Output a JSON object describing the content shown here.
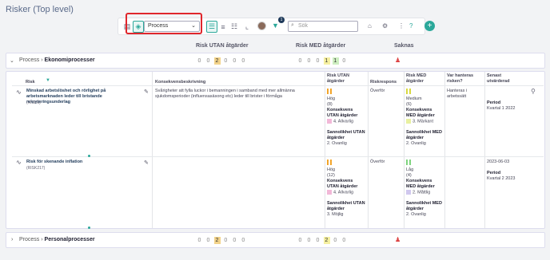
{
  "page": {
    "title": "Risker (Top level)"
  },
  "toolbar": {
    "select_value": "Process",
    "search_placeholder": "Sök",
    "filter_badge": "1",
    "add_label": "+"
  },
  "columns": {
    "risk_utan": "Risk UTAN åtgärder",
    "risk_med": "Risk MED åtgärder",
    "saknas": "Saknas"
  },
  "groups": [
    {
      "prefix": "Process",
      "name": "Ekonomiprocesser",
      "utan": [
        "0",
        "0",
        "2",
        "0",
        "0",
        "0"
      ],
      "med": [
        "0",
        "0",
        "0",
        "1",
        "1",
        "0"
      ]
    },
    {
      "prefix": "Process",
      "name": "Personalprocesser",
      "utan": [
        "0",
        "0",
        "2",
        "0",
        "0",
        "0"
      ],
      "med": [
        "0",
        "0",
        "0",
        "2",
        "0",
        "0"
      ]
    }
  ],
  "table": {
    "headers": {
      "risk": "Risk",
      "konsekvens": "Konsekvensbeskrivning",
      "risk_utan": "Risk UTAN åtgärder",
      "riskrespons": "Riskrespons",
      "risk_med": "Risk MED åtgärder",
      "hanteras": "Var hanteras risken?",
      "senast": "Senast utvärderad"
    },
    "rows": [
      {
        "name": "Minskad arbetslöshet och rörlighet på arbetsmarknaden leder till bristande rekryteringsunderlag",
        "id": "(RISK6)",
        "konsekvens": "Svårigheter att fylla luckor i bemanningen i samband med mer allmänna sjukdomsperioder (influensasäsong etc) leder till brister i förmåga",
        "utan_level": "Hög",
        "utan_score": "(8)",
        "utan_kons_label": "Konsekvens UTAN åtgärder",
        "utan_kons": "4. Allvarlig",
        "utan_sann_label": "Sannolikhet UTAN åtgärder",
        "utan_sann": "2. Ovanlig",
        "respons": "Överför",
        "med_level": "Medium",
        "med_score": "(6)",
        "med_kons_label": "Konsekvens MED åtgärder",
        "med_kons": "3. Märkant",
        "med_sann_label": "Sannolikhet MED åtgärder",
        "med_sann": "2. Ovanlig",
        "hanteras": "Hanteras i arbetssätt",
        "period_label": "Period",
        "period": "Kvartal 1 2022",
        "date": ""
      },
      {
        "name": "Risk för skenande inflation",
        "id": "(RISK217)",
        "konsekvens": "",
        "utan_level": "Hög",
        "utan_score": "(12)",
        "utan_kons_label": "Konsekvens UTAN åtgärder",
        "utan_kons": "4. Allvarlig",
        "utan_sann_label": "Sannolikhet UTAN åtgärder",
        "utan_sann": "3. Möjlig",
        "respons": "Överför",
        "med_level": "Låg",
        "med_score": "(4)",
        "med_kons_label": "Konsekvens MED åtgärder",
        "med_kons": "2. Måttlig",
        "med_sann_label": "Sannolikhet MED åtgärder",
        "med_sann": "2. Ovanlig",
        "hanteras": "",
        "period_label": "Period",
        "period": "Kvartal 2 2023",
        "date": "2023-06-03"
      }
    ]
  },
  "colors": {
    "accent": "#2ba89a",
    "highlight": "#e0262c",
    "high": "#f3a52a",
    "medium": "#e6e85a",
    "low": "#7ed37e"
  }
}
